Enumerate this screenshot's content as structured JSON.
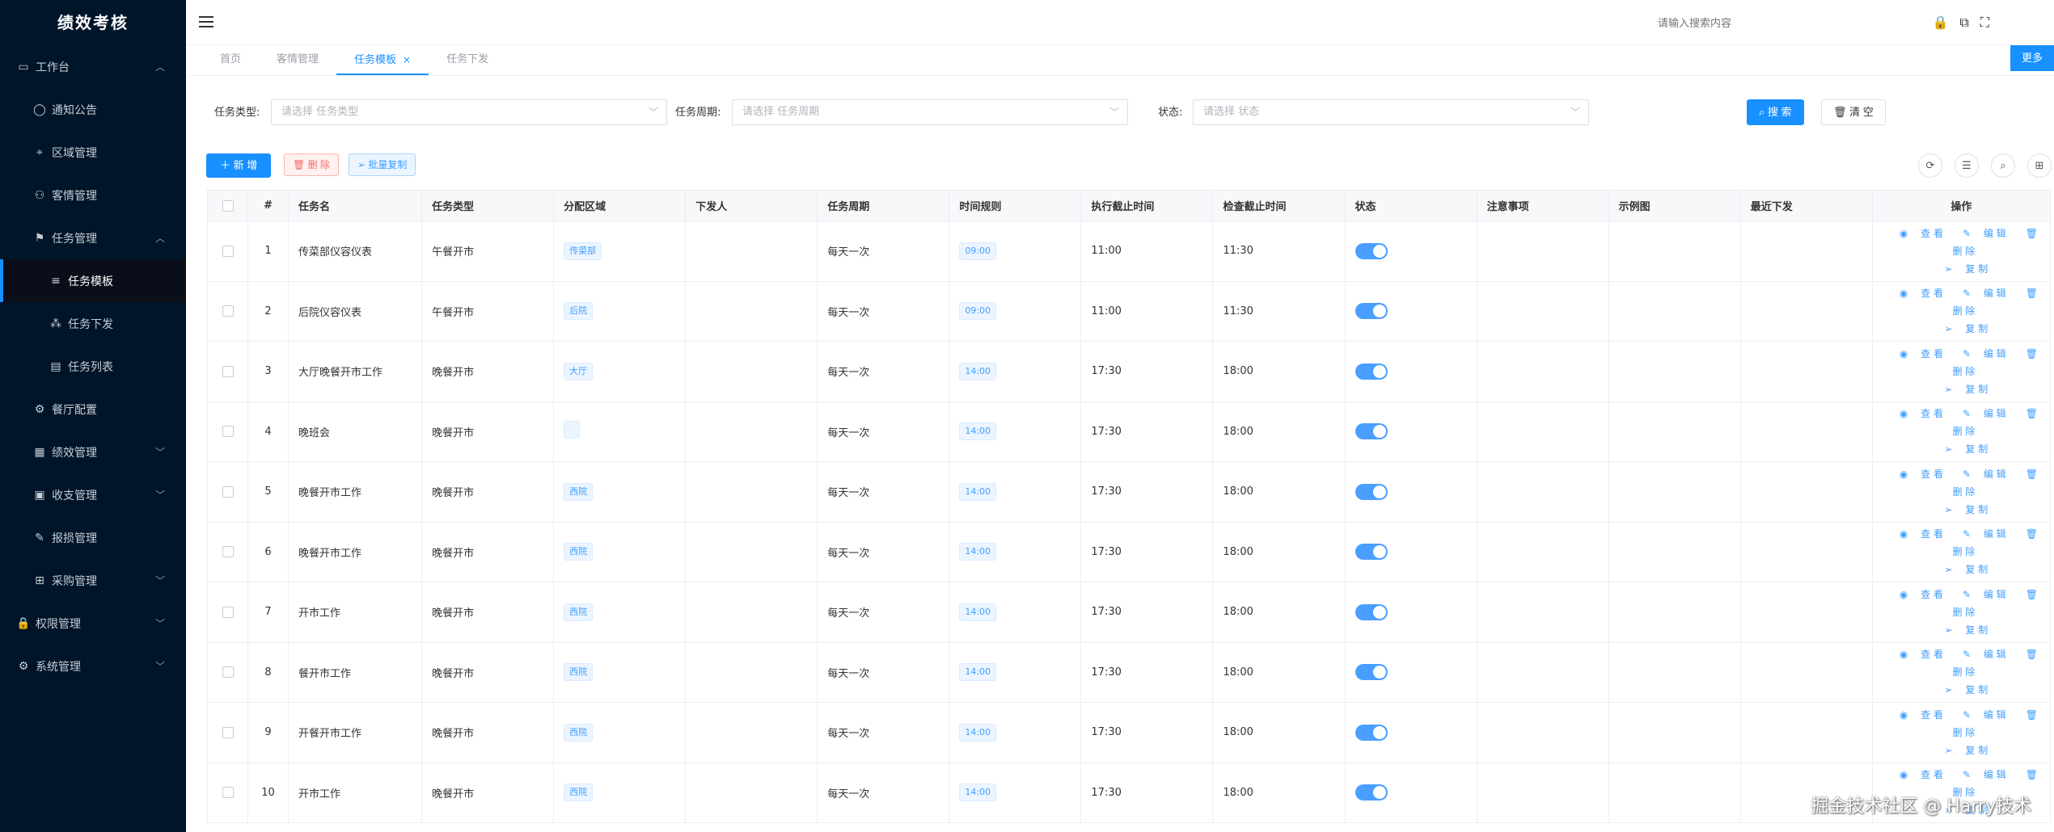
{
  "app": {
    "title": "绩效考核"
  },
  "sidebar": {
    "items": [
      {
        "label": "工作台",
        "icon": "monitor-icon",
        "glyph": "▭",
        "level": 1,
        "chevron": "︿"
      },
      {
        "label": "通知公告",
        "icon": "chat-icon",
        "glyph": "◯",
        "level": 2,
        "chevron": ""
      },
      {
        "label": "区域管理",
        "icon": "location-icon",
        "glyph": "⌖",
        "level": 2,
        "chevron": ""
      },
      {
        "label": "客情管理",
        "icon": "user-icon",
        "glyph": "⚇",
        "level": 2,
        "chevron": ""
      },
      {
        "label": "任务管理",
        "icon": "flag-icon",
        "glyph": "⚑",
        "level": 2,
        "chevron": "︿"
      },
      {
        "label": "任务模板",
        "icon": "list-icon",
        "glyph": "≡",
        "level": 3,
        "chevron": "",
        "active": true
      },
      {
        "label": "任务下发",
        "icon": "grid-icon",
        "glyph": "⁂",
        "level": 3,
        "chevron": ""
      },
      {
        "label": "任务列表",
        "icon": "book-icon",
        "glyph": "▤",
        "level": 3,
        "chevron": ""
      },
      {
        "label": "餐厅配置",
        "icon": "gear-icon",
        "glyph": "⚙",
        "level": 2,
        "chevron": ""
      },
      {
        "label": "绩效管理",
        "icon": "calculator-icon",
        "glyph": "▦",
        "level": 2,
        "chevron": "﹀"
      },
      {
        "label": "收支管理",
        "icon": "wallet-icon",
        "glyph": "▣",
        "level": 2,
        "chevron": "﹀"
      },
      {
        "label": "报损管理",
        "icon": "edit-doc-icon",
        "glyph": "✎",
        "level": 2,
        "chevron": ""
      },
      {
        "label": "采购管理",
        "icon": "apps-icon",
        "glyph": "⊞",
        "level": 2,
        "chevron": "﹀"
      },
      {
        "label": "权限管理",
        "icon": "lock-icon",
        "glyph": "🔒",
        "level": 1,
        "chevron": "﹀"
      },
      {
        "label": "系统管理",
        "icon": "settings-icon",
        "glyph": "⚙",
        "level": 1,
        "chevron": "﹀"
      }
    ]
  },
  "header": {
    "search_placeholder": "请输入搜索内容"
  },
  "tabs": [
    {
      "label": "首页",
      "active": false
    },
    {
      "label": "客情管理",
      "active": false
    },
    {
      "label": "任务模板",
      "active": true,
      "close": "×"
    },
    {
      "label": "任务下发",
      "active": false
    }
  ],
  "more_label": "更多",
  "filters": {
    "task_type_label": "任务类型:",
    "task_type_placeholder": "请选择 任务类型",
    "task_cycle_label": "任务周期:",
    "task_cycle_placeholder": "请选择 任务周期",
    "status_label": "状态:",
    "status_placeholder": "请选择 状态",
    "search_label": "搜 索",
    "clear_label": "清 空"
  },
  "toolbar": {
    "add_label": "新 增",
    "delete_label": "删 除",
    "batch_copy_label": "批量复制"
  },
  "table": {
    "columns": [
      "#",
      "任务名",
      "任务类型",
      "分配区域",
      "下发人",
      "任务周期",
      "时间规则",
      "执行截止时间",
      "检查截止时间",
      "状态",
      "注意事项",
      "示例图",
      "最近下发",
      "操作"
    ],
    "rows": [
      {
        "idx": "1",
        "name": "传菜部仪容仪表",
        "type": "午餐开市",
        "area": "传菜部",
        "issuer": "",
        "cycle": "每天一次",
        "time_rule": "09:00",
        "exec_deadline": "11:00",
        "check_deadline": "11:30",
        "status": true
      },
      {
        "idx": "2",
        "name": "后院仪容仪表",
        "type": "午餐开市",
        "area": "后院",
        "issuer": "",
        "cycle": "每天一次",
        "time_rule": "09:00",
        "exec_deadline": "11:00",
        "check_deadline": "11:30",
        "status": true
      },
      {
        "idx": "3",
        "name": "大厅晚餐开市工作",
        "type": "晚餐开市",
        "area": "大厅",
        "issuer": "",
        "cycle": "每天一次",
        "time_rule": "14:00",
        "exec_deadline": "17:30",
        "check_deadline": "18:00",
        "status": true
      },
      {
        "idx": "4",
        "name": "晚班会",
        "type": "晚餐开市",
        "area": "",
        "issuer": "",
        "cycle": "每天一次",
        "time_rule": "14:00",
        "exec_deadline": "17:30",
        "check_deadline": "18:00",
        "status": true
      },
      {
        "idx": "5",
        "name": "晚餐开市工作",
        "type": "晚餐开市",
        "area": "西院",
        "issuer": "",
        "cycle": "每天一次",
        "time_rule": "14:00",
        "exec_deadline": "17:30",
        "check_deadline": "18:00",
        "status": true
      },
      {
        "idx": "6",
        "name": "晚餐开市工作",
        "type": "晚餐开市",
        "area": "西院",
        "issuer": "",
        "cycle": "每天一次",
        "time_rule": "14:00",
        "exec_deadline": "17:30",
        "check_deadline": "18:00",
        "status": true
      },
      {
        "idx": "7",
        "name": "开市工作",
        "type": "晚餐开市",
        "area": "西院",
        "issuer": "",
        "cycle": "每天一次",
        "time_rule": "14:00",
        "exec_deadline": "17:30",
        "check_deadline": "18:00",
        "status": true
      },
      {
        "idx": "8",
        "name": "餐开市工作",
        "type": "晚餐开市",
        "area": "西院",
        "issuer": "",
        "cycle": "每天一次",
        "time_rule": "14:00",
        "exec_deadline": "17:30",
        "check_deadline": "18:00",
        "status": true
      },
      {
        "idx": "9",
        "name": "开餐开市工作",
        "type": "晚餐开市",
        "area": "西院",
        "issuer": "",
        "cycle": "每天一次",
        "time_rule": "14:00",
        "exec_deadline": "17:30",
        "check_deadline": "18:00",
        "status": true
      },
      {
        "idx": "10",
        "name": "开市工作",
        "type": "晚餐开市",
        "area": "西院",
        "issuer": "",
        "cycle": "每天一次",
        "time_rule": "14:00",
        "exec_deadline": "17:30",
        "check_deadline": "18:00",
        "status": true
      }
    ],
    "actions": {
      "view": "查 看",
      "edit": "编 辑",
      "delete": "删 除",
      "copy": "复 制"
    }
  },
  "watermark": "掘金技术社区 @ Harry技术",
  "colors": {
    "primary": "#1890ff",
    "sidebar_bg": "#001529",
    "danger": "#f56c6c"
  }
}
